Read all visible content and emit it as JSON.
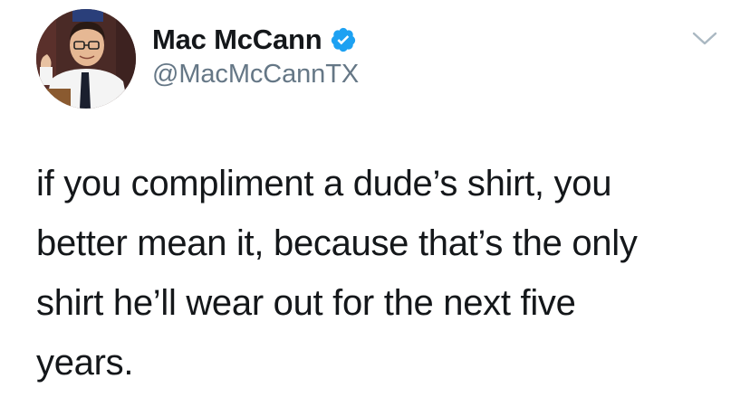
{
  "tweet": {
    "author": {
      "display_name": "Mac McCann",
      "handle": "@MacMcCannTX",
      "verified": true,
      "avatar": "profile-photo"
    },
    "text_lines": [
      "if you compliment a dude’s shirt, you",
      "better mean it, because that’s the only",
      "shirt he’ll wear out for the next five",
      "years."
    ],
    "icons": {
      "verified": "verified-badge-icon",
      "menu": "chevron-down-icon"
    },
    "colors": {
      "verified_blue": "#1da1f2",
      "handle_gray": "#657786",
      "text": "#14171a",
      "caret_gray": "#aab8c2"
    }
  }
}
